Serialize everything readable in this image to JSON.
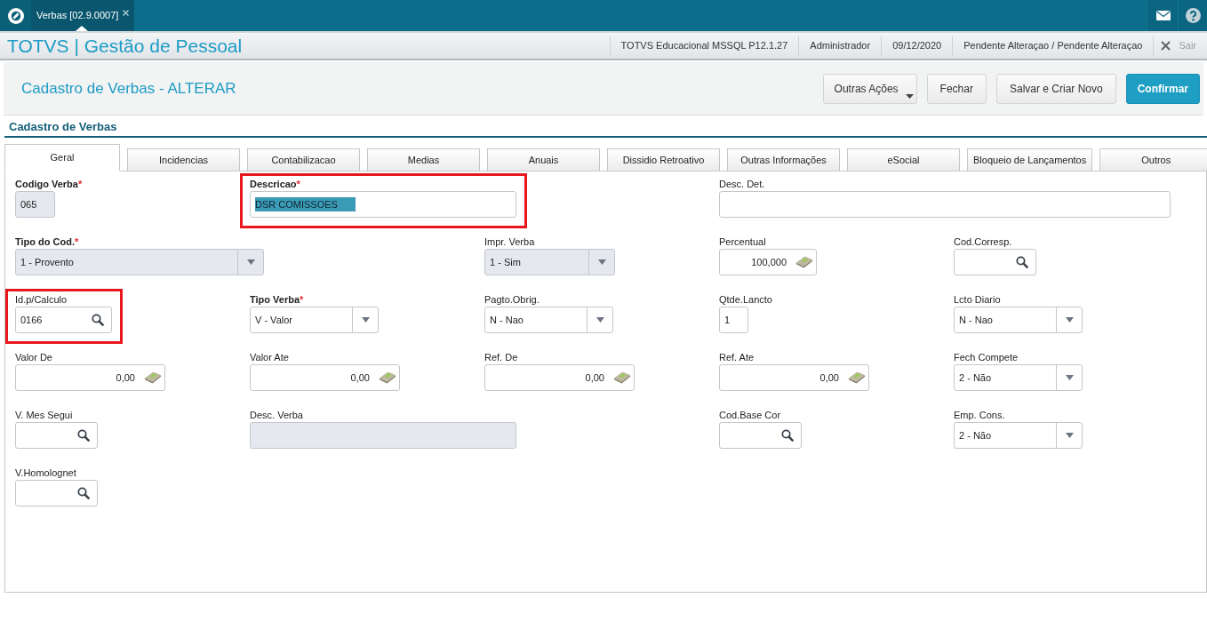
{
  "top_bar": {
    "tabs": [
      {
        "label": "Verbas [02.9.0007]",
        "selected": true
      }
    ]
  },
  "header": {
    "title": "TOTVS | Gestão de Pessoal",
    "items": [
      "TOTVS Educacional MSSQL P12.1.27",
      "Administrador",
      "09/12/2020",
      "Pendente Alteraçao / Pendente Alteraçao"
    ],
    "logout": "Sair"
  },
  "page": {
    "title": "Cadastro de Verbas - ALTERAR",
    "buttons": [
      {
        "label": "Outras Ações",
        "kind": "menu"
      },
      {
        "label": "Fechar",
        "kind": "default"
      },
      {
        "label": "Salvar e Criar Novo",
        "kind": "default"
      },
      {
        "label": "Confirmar",
        "kind": "primary"
      }
    ]
  },
  "form": {
    "title": "Cadastro de Verbas",
    "tabs": [
      {
        "label": "Geral",
        "selected": true
      },
      {
        "label": "Incidencias",
        "selected": false
      },
      {
        "label": "Contabilizacao",
        "selected": false
      },
      {
        "label": "Medias",
        "selected": false
      },
      {
        "label": "Anuais",
        "selected": false
      },
      {
        "label": "Dissidio Retroativo",
        "selected": false
      },
      {
        "label": "Outras Informações",
        "selected": false
      },
      {
        "label": "eSocial",
        "selected": false
      },
      {
        "label": "Bloqueio de Lançamentos",
        "selected": false
      },
      {
        "label": "Outros",
        "selected": false
      }
    ],
    "rows": [
      [
        {
          "label": "Codigo Verba",
          "required": true,
          "required_mark": "*",
          "kind": "text",
          "value": "065",
          "disabled": true,
          "text_selected": false,
          "highlighted": false
        },
        {
          "label": "Descricao",
          "required": true,
          "required_mark": "*",
          "kind": "text",
          "value": "DSR COMISSOES",
          "disabled": false,
          "text_selected": true,
          "highlighted": true
        },
        {
          "label": "Desc. Det.",
          "required": false,
          "kind": "text",
          "disabled": false,
          "highlighted": false
        }
      ],
      [
        {
          "label": "Tipo do Cod.",
          "required": true,
          "required_mark": "*",
          "kind": "select",
          "value": "1 - Provento",
          "disabled": true,
          "text_selected": false,
          "highlighted": false
        },
        {
          "label": "Impr. Verba",
          "required": false,
          "kind": "select",
          "value": "1 - Sim",
          "disabled": true,
          "text_selected": false,
          "highlighted": false
        },
        {
          "label": "Percentual",
          "required": false,
          "kind": "number",
          "value": "100,000",
          "disabled": false,
          "text_selected": false,
          "highlighted": false
        },
        {
          "label": "Cod.Corresp.",
          "required": false,
          "kind": "lookup",
          "disabled": false,
          "highlighted": false
        }
      ],
      [
        {
          "label": "Id.p/Calculo",
          "required": false,
          "kind": "lookup",
          "value": "0166",
          "disabled": false,
          "text_selected": false,
          "highlighted": true
        },
        {
          "label": "Tipo Verba",
          "required": true,
          "required_mark": "*",
          "kind": "select",
          "value": "V - Valor",
          "disabled": false,
          "text_selected": false,
          "highlighted": false
        },
        {
          "label": "Pagto.Obrig.",
          "required": false,
          "kind": "select",
          "value": "N - Nao",
          "disabled": false,
          "text_selected": false,
          "highlighted": false
        },
        {
          "label": "Qtde.Lancto",
          "required": false,
          "kind": "text",
          "value": "1",
          "disabled": false,
          "text_selected": false,
          "highlighted": false
        },
        {
          "label": "Lcto Diario",
          "required": false,
          "kind": "select",
          "value": "N - Nao",
          "disabled": false,
          "text_selected": false,
          "highlighted": false
        }
      ],
      [
        {
          "label": "Valor De",
          "required": false,
          "kind": "number",
          "value": "0,00",
          "disabled": false,
          "text_selected": false,
          "highlighted": false
        },
        {
          "label": "Valor Ate",
          "required": false,
          "kind": "number",
          "value": "0,00",
          "disabled": false,
          "text_selected": false,
          "highlighted": false
        },
        {
          "label": "Ref. De",
          "required": false,
          "kind": "number",
          "value": "0,00",
          "disabled": false,
          "text_selected": false,
          "highlighted": false
        },
        {
          "label": "Ref. Ate",
          "required": false,
          "kind": "number",
          "value": "0,00",
          "disabled": false,
          "text_selected": false,
          "highlighted": false
        },
        {
          "label": "Fech Compete",
          "required": false,
          "kind": "select",
          "value": "2 - Não",
          "disabled": false,
          "text_selected": false,
          "highlighted": false
        }
      ],
      [
        {
          "label": "V. Mes Segui",
          "required": false,
          "kind": "lookup",
          "disabled": false,
          "highlighted": false
        },
        {
          "label": "Desc. Verba",
          "required": false,
          "kind": "text",
          "disabled": true,
          "highlighted": false
        },
        {
          "label": "Cod.Base Cor",
          "required": false,
          "kind": "lookup",
          "disabled": false,
          "highlighted": false
        },
        {
          "label": "Emp. Cons.",
          "required": false,
          "kind": "select",
          "value": "2 - Não",
          "disabled": false,
          "text_selected": false,
          "highlighted": false
        }
      ],
      [
        {
          "label": "V.Homolognet",
          "required": false,
          "kind": "lookup",
          "disabled": false,
          "highlighted": false
        }
      ]
    ]
  }
}
